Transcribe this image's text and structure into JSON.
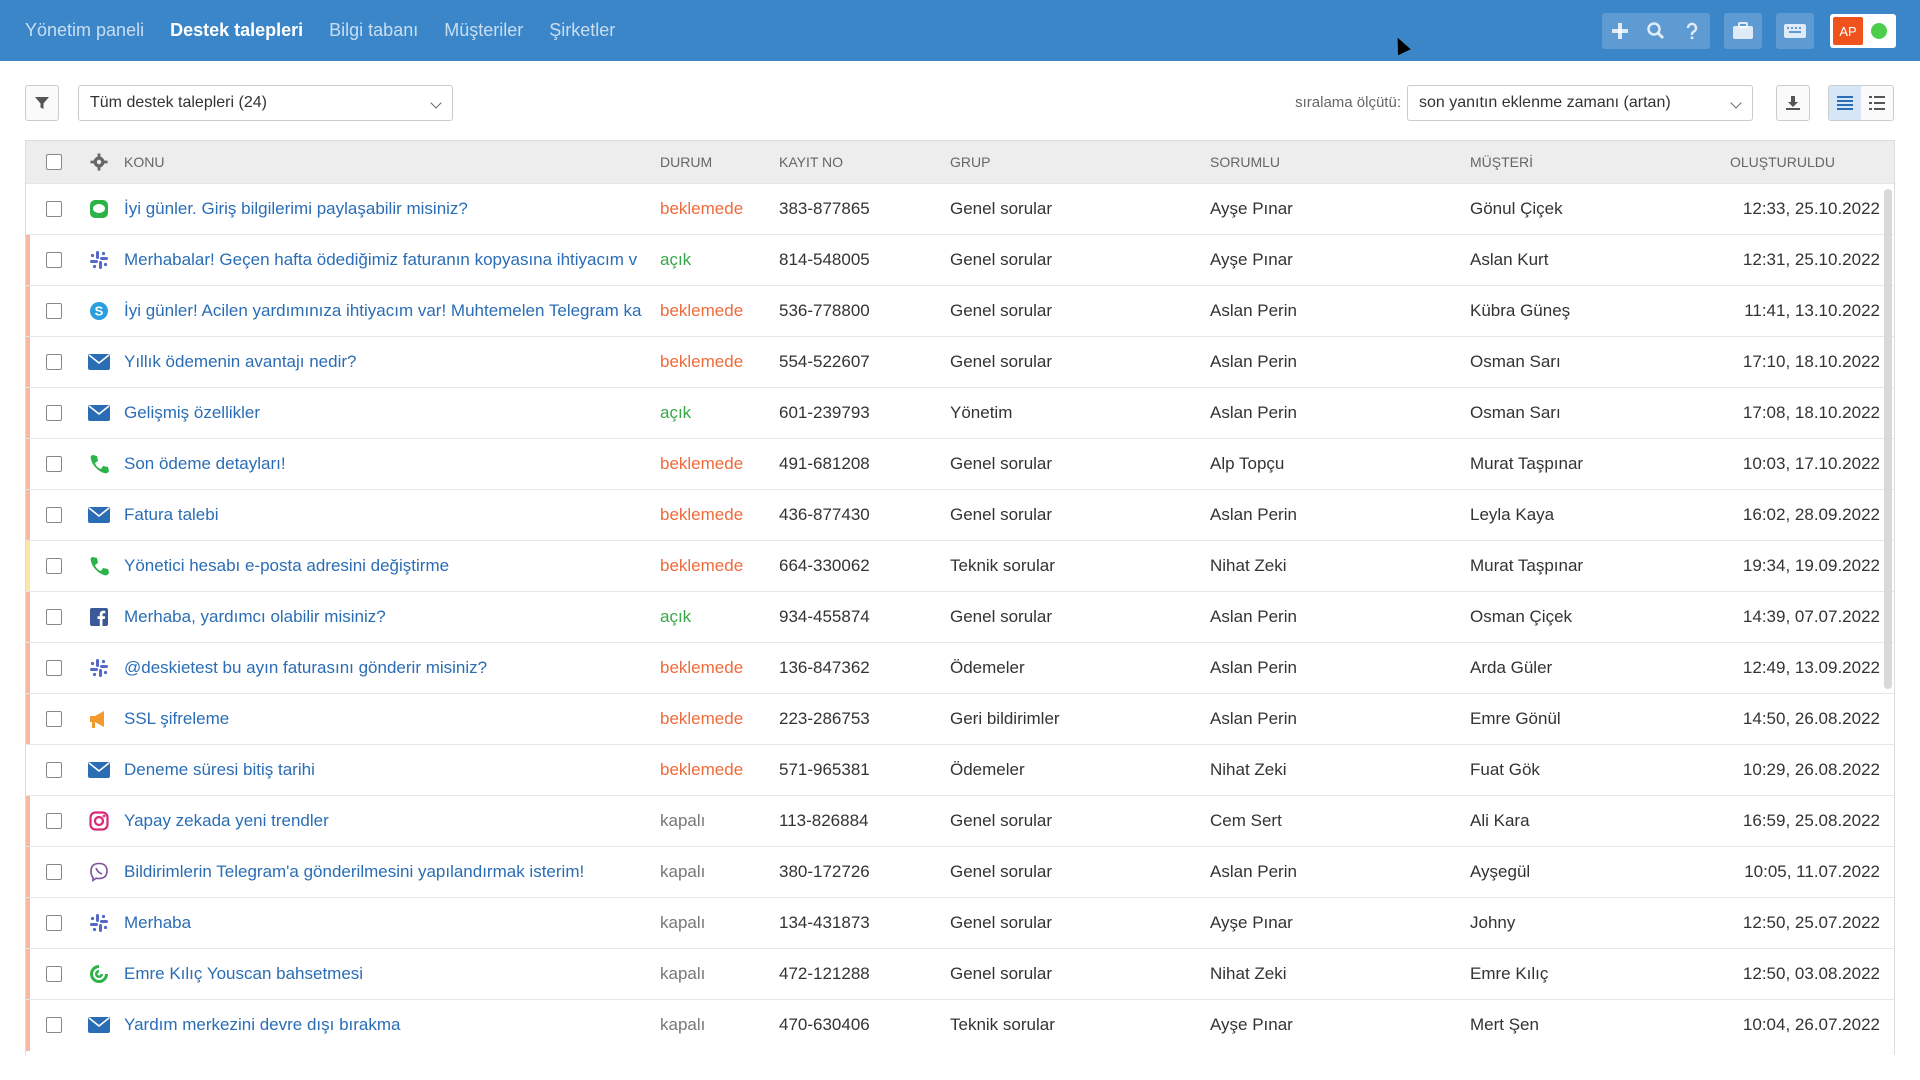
{
  "nav": {
    "items": [
      {
        "label": "Yönetim paneli",
        "active": false
      },
      {
        "label": "Destek talepleri",
        "active": true
      },
      {
        "label": "Bilgi tabanı",
        "active": false
      },
      {
        "label": "Müşteriler",
        "active": false
      },
      {
        "label": "Şirketler",
        "active": false
      }
    ]
  },
  "topbar": {
    "add_icon": "plus-icon",
    "search_icon": "search-icon",
    "help_icon": "question-icon",
    "briefcase_icon": "briefcase-icon",
    "keyboard_icon": "keyboard-icon",
    "avatar_initials": "AP",
    "status_color": "#4cce4c"
  },
  "toolbar": {
    "view_select": "Tüm destek talepleri (24)",
    "sort_label": "sıralama ölçütü:",
    "sort_select": "son yanıtın eklenme zamanı (artan)"
  },
  "table": {
    "columns": {
      "subject": "KONU",
      "status": "DURUM",
      "id": "KAYIT NO",
      "group": "GRUP",
      "responsible": "SORUMLU",
      "customer": "MÜŞTERİ",
      "created": "OLUŞTURULDU"
    },
    "rows": [
      {
        "channel": "line-icon",
        "priority": "none",
        "subject": "İyi günler. Giriş bilgilerimi paylaşabilir misiniz?",
        "status": "beklemede",
        "id": "383-877865",
        "group": "Genel sorular",
        "responsible": "Ayşe Pınar",
        "customer": "Gönul Çiçek",
        "created": "12:33, 25.10.2022"
      },
      {
        "channel": "slack-icon",
        "priority": "high",
        "subject": "Merhabalar! Geçen hafta ödediğimiz faturanın kopyasına ihtiyacım v",
        "status": "açık",
        "id": "814-548005",
        "group": "Genel sorular",
        "responsible": "Ayşe Pınar",
        "customer": "Aslan Kurt",
        "created": "12:31, 25.10.2022"
      },
      {
        "channel": "skype-icon",
        "priority": "high",
        "subject": "İyi günler! Acilen yardımınıza ihtiyacım var! Muhtemelen Telegram ka",
        "status": "beklemede",
        "id": "536-778800",
        "group": "Genel sorular",
        "responsible": "Aslan Perin",
        "customer": "Kübra Güneş",
        "created": "11:41, 13.10.2022"
      },
      {
        "channel": "email-icon",
        "priority": "high",
        "subject": "Yıllık ödemenin avantajı nedir?",
        "status": "beklemede",
        "id": "554-522607",
        "group": "Genel sorular",
        "responsible": "Aslan Perin",
        "customer": "Osman Sarı",
        "created": "17:10, 18.10.2022"
      },
      {
        "channel": "email-icon",
        "priority": "high",
        "subject": "Gelişmiş özellikler",
        "status": "açık",
        "id": "601-239793",
        "group": "Yönetim",
        "responsible": "Aslan Perin",
        "customer": "Osman Sarı",
        "created": "17:08, 18.10.2022"
      },
      {
        "channel": "phone-icon",
        "priority": "high",
        "subject": "Son ödeme detayları!",
        "status": "beklemede",
        "id": "491-681208",
        "group": "Genel sorular",
        "responsible": "Alp Topçu",
        "customer": "Murat Taşpınar",
        "created": "10:03, 17.10.2022"
      },
      {
        "channel": "email-icon",
        "priority": "high",
        "subject": "Fatura talebi",
        "status": "beklemede",
        "id": "436-877430",
        "group": "Genel sorular",
        "responsible": "Aslan Perin",
        "customer": "Leyla Kaya",
        "created": "16:02, 28.09.2022"
      },
      {
        "channel": "phone-icon",
        "priority": "medium",
        "subject": "Yönetici hesabı e-posta adresini değiştirme",
        "status": "beklemede",
        "id": "664-330062",
        "group": "Teknik sorular",
        "responsible": "Nihat Zeki",
        "customer": "Murat Taşpınar",
        "created": "19:34, 19.09.2022"
      },
      {
        "channel": "facebook-icon",
        "priority": "high",
        "subject": "Merhaba, yardımcı olabilir misiniz?",
        "status": "açık",
        "id": "934-455874",
        "group": "Genel sorular",
        "responsible": "Aslan Perin",
        "customer": "Osman Çiçek",
        "created": "14:39, 07.07.2022"
      },
      {
        "channel": "slack-icon",
        "priority": "high",
        "subject": "@deskietest bu ayın faturasını gönderir misiniz?",
        "status": "beklemede",
        "id": "136-847362",
        "group": "Ödemeler",
        "responsible": "Aslan Perin",
        "customer": "Arda Güler",
        "created": "12:49, 13.09.2022"
      },
      {
        "channel": "megaphone-icon",
        "priority": "high",
        "subject": "SSL şifreleme",
        "status": "beklemede",
        "id": "223-286753",
        "group": "Geri bildirimler",
        "responsible": "Aslan Perin",
        "customer": "Emre Gönül",
        "created": "14:50, 26.08.2022"
      },
      {
        "channel": "email-icon",
        "priority": "none",
        "subject": "Deneme süresi bitiş tarihi",
        "status": "beklemede",
        "id": "571-965381",
        "group": "Ödemeler",
        "responsible": "Nihat Zeki",
        "customer": "Fuat Gök",
        "created": "10:29, 26.08.2022"
      },
      {
        "channel": "instagram-icon",
        "priority": "high",
        "subject": "Yapay zekada yeni trendler",
        "status": "kapalı",
        "id": "113-826884",
        "group": "Genel sorular",
        "responsible": "Cem Sert",
        "customer": "Ali Kara",
        "created": "16:59, 25.08.2022"
      },
      {
        "channel": "viber-icon",
        "priority": "high",
        "subject": "Bildirimlerin Telegram'a gönderilmesini yapılandırmak isterim!",
        "status": "kapalı",
        "id": "380-172726",
        "group": "Genel sorular",
        "responsible": "Aslan Perin",
        "customer": "Ayşegül",
        "created": "10:05, 11.07.2022"
      },
      {
        "channel": "slack-icon",
        "priority": "high",
        "subject": "Merhaba",
        "status": "kapalı",
        "id": "134-431873",
        "group": "Genel sorular",
        "responsible": "Ayşe Pınar",
        "customer": "Johny",
        "created": "12:50, 25.07.2022"
      },
      {
        "channel": "youscan-icon",
        "priority": "high",
        "subject": "Emre Kılıç Youscan bahsetmesi",
        "status": "kapalı",
        "id": "472-121288",
        "group": "Genel sorular",
        "responsible": "Nihat Zeki",
        "customer": "Emre Kılıç",
        "created": "12:50, 03.08.2022"
      },
      {
        "channel": "email-icon",
        "priority": "high",
        "subject": "Yardım merkezini devre dışı bırakma",
        "status": "kapalı",
        "id": "470-630406",
        "group": "Teknik sorular",
        "responsible": "Ayşe Pınar",
        "customer": "Mert Şen",
        "created": "10:04, 26.07.2022"
      }
    ]
  },
  "colors": {
    "topbar": "#3b86c9",
    "link": "#2a6db5",
    "status_pending": "#f06a3a",
    "status_open": "#3aa64a",
    "status_closed": "#777777",
    "priority_high": "#f7b9a2",
    "priority_medium": "#fbe6a8"
  }
}
